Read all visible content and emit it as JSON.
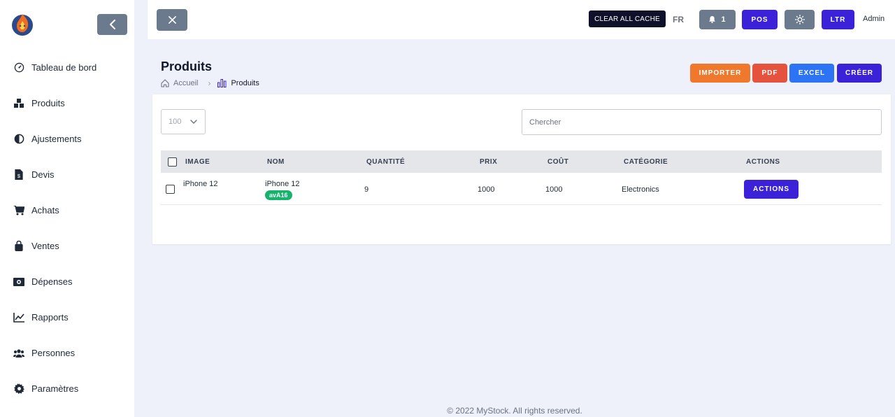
{
  "sidebar": {
    "items": [
      {
        "label": "Tableau de bord",
        "icon": "dashboard-icon"
      },
      {
        "label": "Produits",
        "icon": "boxes-icon"
      },
      {
        "label": "Ajustements",
        "icon": "contrast-icon"
      },
      {
        "label": "Devis",
        "icon": "invoice-icon"
      },
      {
        "label": "Achats",
        "icon": "cart-icon"
      },
      {
        "label": "Ventes",
        "icon": "bag-icon"
      },
      {
        "label": "Dépenses",
        "icon": "money-icon"
      },
      {
        "label": "Rapports",
        "icon": "chart-line-icon"
      },
      {
        "label": "Personnes",
        "icon": "users-icon"
      },
      {
        "label": "Paramètres",
        "icon": "gear-icon"
      }
    ]
  },
  "topbar": {
    "cache_label": "CLEAR ALL CACHE",
    "lang": "FR",
    "notif_count": "1",
    "pos_label": "POS",
    "ltr_label": "LTR",
    "user": "Admin"
  },
  "header": {
    "title": "Produits",
    "breadcrumb_home": "Accueil",
    "breadcrumb_current": "Produits",
    "import_label": "IMPORTER",
    "pdf_label": "PDF",
    "excel_label": "EXCEL",
    "create_label": "CRÉER"
  },
  "table": {
    "per_page": "100",
    "search_placeholder": "Chercher",
    "columns": {
      "image": "IMAGE",
      "name": "NOM",
      "quantity": "QUANTITÉ",
      "price": "PRIX",
      "cost": "COÛT",
      "category": "CATÉGORIE",
      "actions": "ACTIONS"
    },
    "rows": [
      {
        "image": "iPhone 12",
        "name": "iPhone 12",
        "code": "avA16",
        "quantity": "9",
        "price": "1000",
        "cost": "1000",
        "category": "Electronics",
        "actions_label": "ACTIONS"
      }
    ]
  },
  "footer": "© 2022 MyStock. All rights reserved.",
  "colors": {
    "primary": "#3b22d8",
    "import": "#f0782d",
    "pdf": "#e5533f",
    "excel": "#2c74f5",
    "badge": "#15b36b",
    "gray_button": "#6b7a8c"
  }
}
